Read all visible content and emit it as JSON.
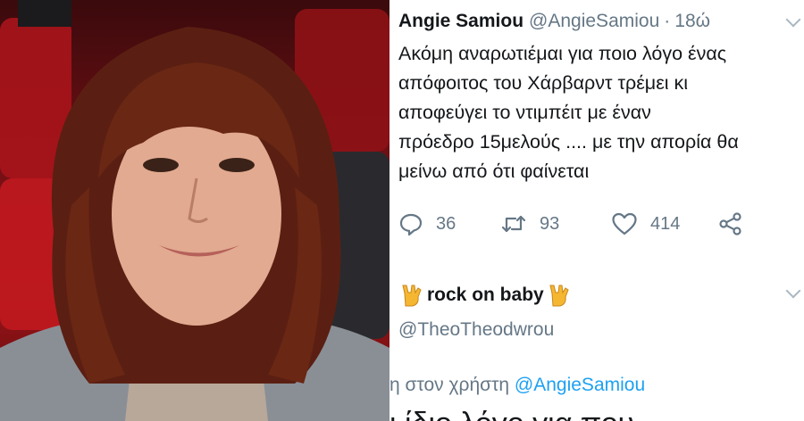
{
  "tweet": {
    "author_name": "Angie Samiou",
    "author_handle": "@AngieSamiou",
    "separator": "·",
    "time": "18ώ",
    "text": "Ακόμη αναρωτιέμαι για ποιο λόγο ένας\nαπόφοιτος του Χάρβαρντ τρέμει κι\nαποφεύγει το ντιμπέιτ με έναν\nπρόεδρο 15μελούς .... με την απορία θα\nμείνω από ότι φαίνεται",
    "actions": {
      "replies": "36",
      "retweets": "93",
      "likes": "414"
    }
  },
  "reply": {
    "author_name": "rock on baby",
    "author_handle": "@TheoTheodwrou",
    "replying_prefix": "η στον χρήστη ",
    "replying_mention": "@AngieSamiou",
    "cut_text": "ι ίδιο λόγο για που"
  },
  "icons": {
    "name_emoji_left": "sign-of-the-horns-icon",
    "name_emoji_right": "sign-of-the-horns-icon",
    "reply": "speech-bubble-icon",
    "retweet": "retweet-arrows-icon",
    "like": "heart-icon",
    "share": "share-nodes-icon",
    "more": "chevron-down-icon"
  },
  "colors": {
    "text_primary": "#14171a",
    "text_secondary": "#657786",
    "link": "#1da1f2",
    "photo_background": "#9b1418"
  }
}
